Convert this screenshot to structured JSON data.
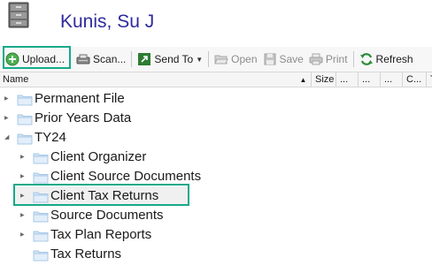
{
  "header": {
    "client_name": "Kunis, Su J",
    "icon": "file-cabinet-icon"
  },
  "toolbar": {
    "buttons": [
      {
        "label": "Upload...",
        "icon": "upload-icon",
        "enabled": true
      },
      {
        "label": "Scan...",
        "icon": "scanner-icon",
        "enabled": true
      },
      {
        "label": "Send To",
        "icon": "send-to-icon",
        "enabled": true,
        "has_dropdown": true
      },
      {
        "label": "Open",
        "icon": "open-folder-icon",
        "enabled": false
      },
      {
        "label": "Save",
        "icon": "save-icon",
        "enabled": false
      },
      {
        "label": "Print",
        "icon": "printer-icon",
        "enabled": false
      },
      {
        "label": "Refresh",
        "icon": "refresh-icon",
        "enabled": true
      }
    ]
  },
  "columns": [
    "Name",
    "Size",
    "...",
    "...",
    "...",
    "C...",
    "T..."
  ],
  "tree": [
    {
      "label": "Permanent File",
      "level": 0,
      "expanded": false,
      "has_children": true
    },
    {
      "label": "Prior Years Data",
      "level": 0,
      "expanded": false,
      "has_children": true
    },
    {
      "label": "TY24",
      "level": 0,
      "expanded": true,
      "has_children": true
    },
    {
      "label": "Client Organizer",
      "level": 1,
      "expanded": false,
      "has_children": true
    },
    {
      "label": "Client Source Documents",
      "level": 1,
      "expanded": false,
      "has_children": true
    },
    {
      "label": "Client Tax Returns",
      "level": 1,
      "expanded": false,
      "has_children": true,
      "highlighted": true
    },
    {
      "label": "Source Documents",
      "level": 1,
      "expanded": false,
      "has_children": true
    },
    {
      "label": "Tax Plan Reports",
      "level": 1,
      "expanded": false,
      "has_children": true
    },
    {
      "label": "Tax Returns",
      "level": 1,
      "expanded": false,
      "has_children": false
    }
  ],
  "colors": {
    "title": "#2e2a9e",
    "highlight": "#17a98a",
    "folder": "#cfe3f5"
  }
}
